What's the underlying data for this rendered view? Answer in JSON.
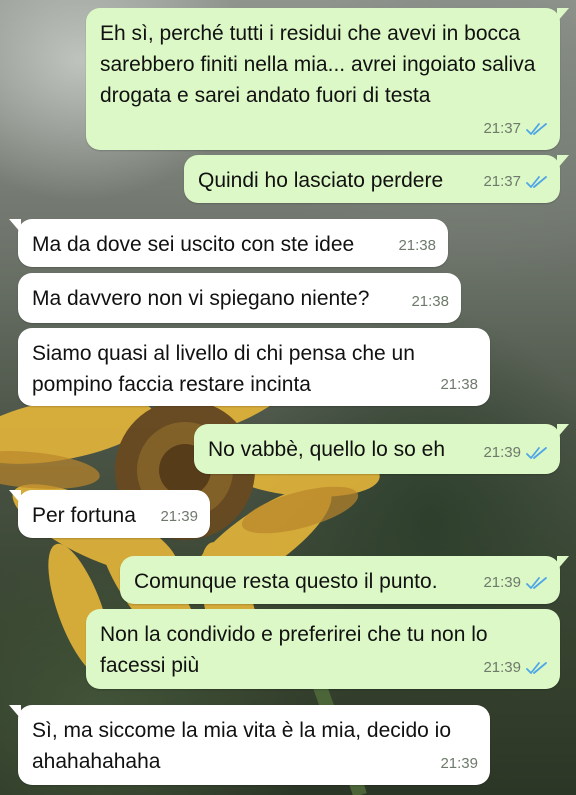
{
  "chat": {
    "tick_color": "#4fa6e6",
    "messages": [
      {
        "direction": "outgoing",
        "text": "Eh sì, perché tutti i residui che avevi in bocca sarebbero finiti nella mia... avrei ingoiato saliva drogata e sarei andato fuori di testa",
        "time": "21:37",
        "status": "read"
      },
      {
        "direction": "outgoing",
        "text": "Quindi ho lasciato perdere",
        "time": "21:37",
        "status": "read"
      },
      {
        "direction": "incoming",
        "text": "Ma da dove sei uscito con ste idee",
        "time": "21:38"
      },
      {
        "direction": "incoming",
        "text": "Ma davvero non vi spiegano niente?",
        "time": "21:38"
      },
      {
        "direction": "incoming",
        "text": "Siamo quasi al livello di chi pensa che un pompino faccia restare incinta",
        "time": "21:38"
      },
      {
        "direction": "outgoing",
        "text": "No vabbè, quello lo so eh",
        "time": "21:39",
        "status": "read"
      },
      {
        "direction": "incoming",
        "text": "Per fortuna",
        "time": "21:39"
      },
      {
        "direction": "outgoing",
        "text": "Comunque resta questo il punto.",
        "time": "21:39",
        "status": "read"
      },
      {
        "direction": "outgoing",
        "text": "Non la condivido e preferirei che tu non lo facessi più",
        "time": "21:39",
        "status": "read"
      },
      {
        "direction": "incoming",
        "text": "Sì, ma siccome la mia vita è la mia, decido io ahahahahaha",
        "time": "21:39"
      }
    ]
  }
}
